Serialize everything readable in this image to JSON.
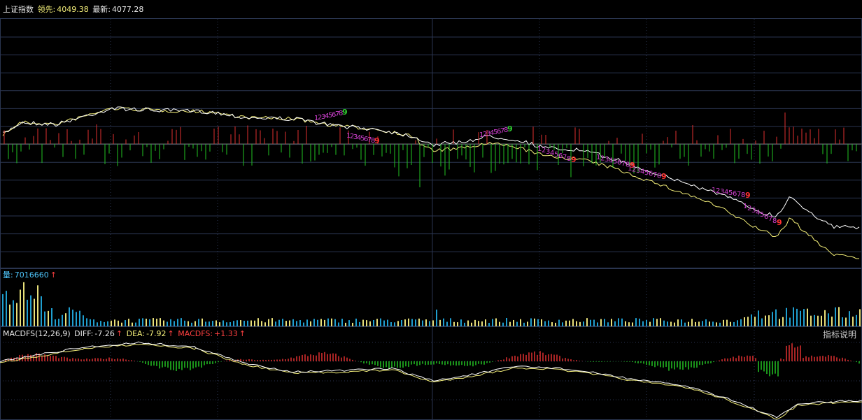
{
  "price_panel": {
    "title": "上证指数",
    "lead_label": "领先:",
    "lead_value": "4049.38",
    "latest_label": "最新:",
    "latest_value": "4077.28"
  },
  "volume_panel": {
    "label": "量:",
    "value": "7016660",
    "arrow": "↑"
  },
  "macd_panel": {
    "name": "MACDFS(12,26,9)",
    "diff_label": "DIFF:",
    "diff_value": "-7.26",
    "diff_arrow": "↑",
    "dea_label": "DEA:",
    "dea_value": "-7.92",
    "dea_arrow": "↑",
    "macdfs_label": "MACDFS:",
    "macdfs_value": "+1.33",
    "macdfs_arrow": "↑"
  },
  "indicator_help": "指标说明",
  "colors": {
    "background": "#000000",
    "grid": "#2a3550",
    "white_line": "#ffffff",
    "yellow_line": "#f5f07a",
    "up_bar": "#e03030",
    "down_bar": "#22c422",
    "vol_cyan": "#1f9fd0",
    "vol_yellow": "#e8e07a",
    "td_magenta": "#d040d0",
    "td_green": "#30d030",
    "td_red": "#ff3030"
  }
}
